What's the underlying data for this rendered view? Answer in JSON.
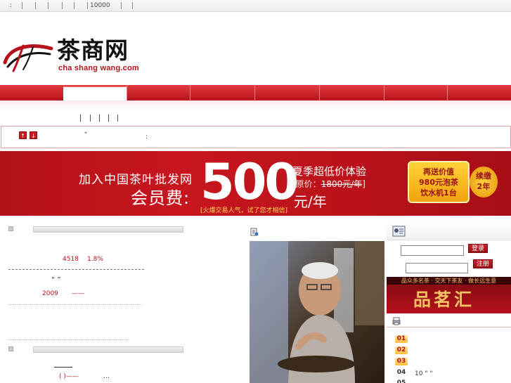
{
  "topbar": {
    "colon": ":",
    "number": "10000"
  },
  "logo": {
    "chinese": "茶商网",
    "domain": "cha shang wang.com"
  },
  "notice": {
    "up_arrow": "↑",
    "down_arrow": "↓",
    "quote": "\"",
    "colon": ":"
  },
  "banner": {
    "join_text": "加入中国茶叶批发网",
    "fee_label": "会员费:",
    "price": "500",
    "season_text": "夏季超低价体验",
    "original_prefix": "[原价：",
    "original_price": "1800元/年",
    "original_suffix": "]",
    "per_year": "元/年",
    "slogan": "[火爆交易人气，试了您才相信]",
    "gift_line1": "再送价值",
    "gift_line2": "980元泡茶",
    "gift_line3": "饮水机1台",
    "renew_line1": "续缴",
    "renew_line2": "2年"
  },
  "left": {
    "stat1": "4518",
    "stat2": "1.8%",
    "quote_marks": "“  ”",
    "year": "2009",
    "dash": "——",
    "paren": "( )——",
    "ellipsis": "…"
  },
  "right": {
    "login_button": "登录",
    "register_button": "注册",
    "ad_top": "品众多名茶 · 交天下茶友 · 做长远生意",
    "ad_title": "品茗汇",
    "list": [
      {
        "num": "01",
        "text": ""
      },
      {
        "num": "02",
        "text": ""
      },
      {
        "num": "03",
        "text": ""
      },
      {
        "num": "04",
        "text": "10 \" \""
      },
      {
        "num": "05",
        "text": ""
      }
    ]
  }
}
